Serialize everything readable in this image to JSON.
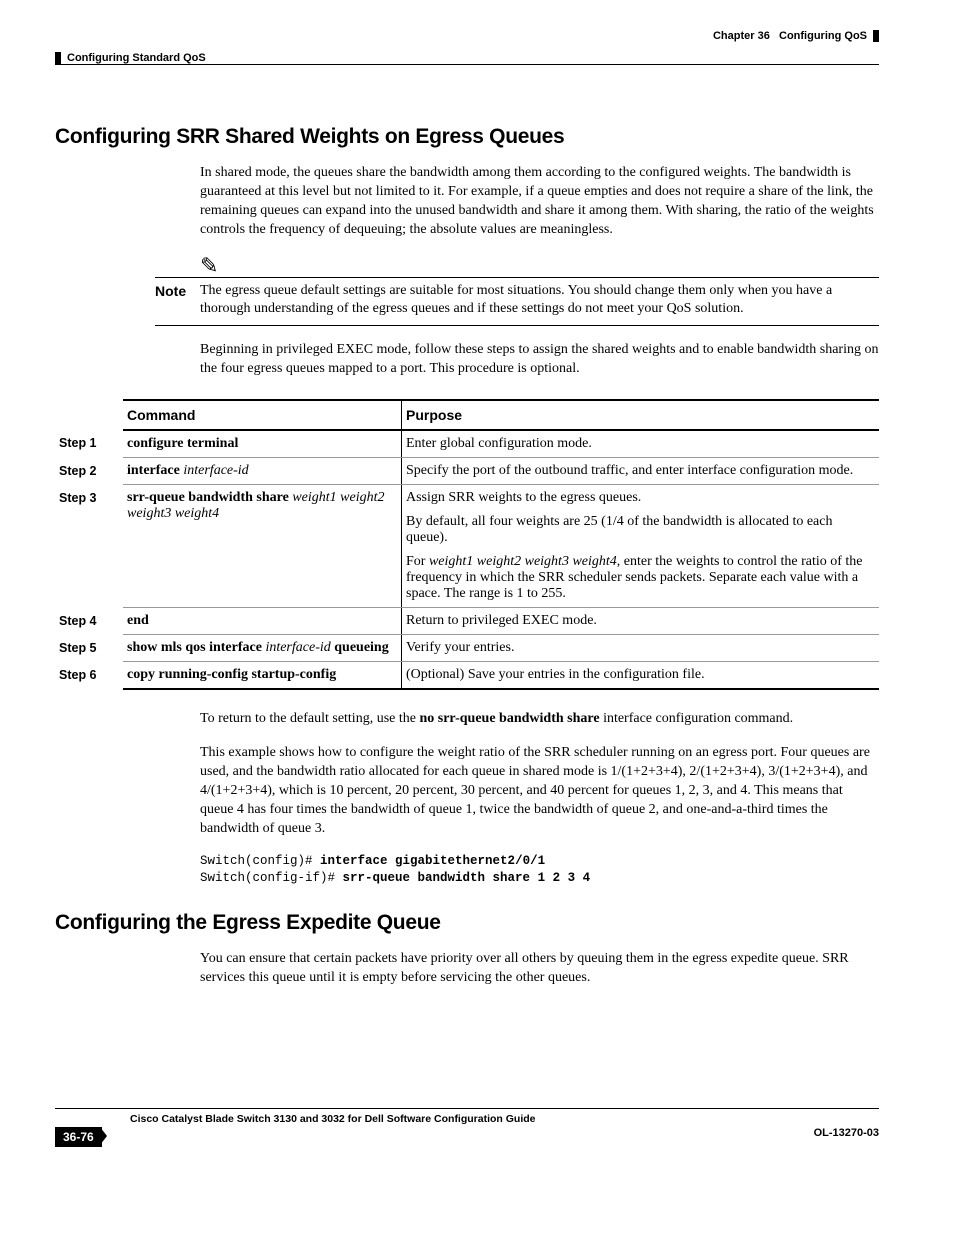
{
  "header": {
    "chapter": "Chapter 36",
    "chapter_title": "Configuring QoS",
    "section": "Configuring Standard QoS"
  },
  "section1": {
    "heading": "Configuring SRR Shared Weights on Egress Queues",
    "intro": "In shared mode, the queues share the bandwidth among them according to the configured weights. The bandwidth is guaranteed at this level but not limited to it. For example, if a queue empties and does not require a share of the link, the remaining queues can expand into the unused bandwidth and share it among them. With sharing, the ratio of the weights controls the frequency of dequeuing; the absolute values are meaningless.",
    "note_label": "Note",
    "note": "The egress queue default settings are suitable for most situations. You should change them only when you have a thorough understanding of the egress queues and if these settings do not meet your QoS solution.",
    "lead_in": "Beginning in privileged EXEC mode, follow these steps to assign the shared weights and to enable bandwidth sharing on the four egress queues mapped to a port. This procedure is optional.",
    "table": {
      "head_step": "",
      "head_command": "Command",
      "head_purpose": "Purpose",
      "rows": [
        {
          "step": "Step 1",
          "cmd_b": "configure terminal",
          "cmd_i": "",
          "purpose": "Enter global configuration mode."
        },
        {
          "step": "Step 2",
          "cmd_b": "interface",
          "cmd_i": " interface-id",
          "purpose": "Specify the port of the outbound traffic, and enter interface configuration mode."
        },
        {
          "step": "Step 3",
          "cmd_b": "srr-queue bandwidth share",
          "cmd_i": " weight1 weight2 weight3 weight4",
          "p1": "Assign SRR weights to the egress queues.",
          "p2": "By default, all four weights are 25 (1/4 of the bandwidth is allocated to each queue).",
          "p3_pre": "For ",
          "p3_i": "weight1 weight2 weight3 weight4",
          "p3_post": ", enter the weights to control the ratio of the frequency in which the SRR scheduler sends packets. Separate each value with a space. The range is 1 to 255."
        },
        {
          "step": "Step 4",
          "cmd_b": "end",
          "cmd_i": "",
          "purpose": "Return to privileged EXEC mode."
        },
        {
          "step": "Step 5",
          "cmd_b": "show mls qos interface",
          "cmd_i": " interface-id",
          "cmd_b2": " queueing",
          "purpose": "Verify your entries."
        },
        {
          "step": "Step 6",
          "cmd_b": "copy running-config startup-config",
          "cmd_i": "",
          "purpose": "(Optional) Save your entries in the configuration file."
        }
      ]
    },
    "outro1_pre": "To return to the default setting, use the ",
    "outro1_b": "no srr-queue bandwidth share",
    "outro1_post": " interface configuration command.",
    "outro2": "This example shows how to configure the weight ratio of the SRR scheduler running on an egress port. Four queues are used, and the bandwidth ratio allocated for each queue in shared mode is 1/(1+2+3+4), 2/(1+2+3+4), 3/(1+2+3+4), and 4/(1+2+3+4), which is 10 percent, 20 percent, 30 percent, and 40 percent for queues 1, 2, 3, and 4. This means that queue 4 has four times the bandwidth of queue 1, twice the bandwidth of queue 2, and one-and-a-third times the bandwidth of queue 3.",
    "code_l1_a": "Switch(config)# ",
    "code_l1_b": "interface gigabitethernet2/0/1",
    "code_l2_a": "Switch(config-if)# ",
    "code_l2_b": "srr-queue bandwidth share 1 2 3 4"
  },
  "section2": {
    "heading": "Configuring the Egress Expedite Queue",
    "intro": "You can ensure that certain packets have priority over all others by queuing them in the egress expedite queue. SRR services this queue until it is empty before servicing the other queues."
  },
  "footer": {
    "title": "Cisco Catalyst Blade Switch 3130 and 3032 for Dell Software Configuration Guide",
    "page": "36-76",
    "doc": "OL-13270-03"
  }
}
